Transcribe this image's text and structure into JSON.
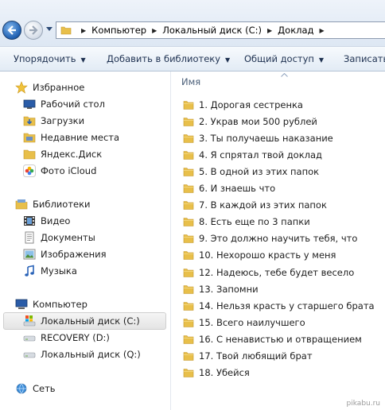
{
  "address_bar": {
    "breadcrumbs": [
      "Компьютер",
      "Локальный диск (C:)",
      "Доклад"
    ]
  },
  "toolbar": {
    "organize_label": "Упорядочить",
    "add_to_library_label": "Добавить в библиотеку",
    "share_label": "Общий доступ",
    "burn_label": "Записать"
  },
  "nav_pane": {
    "favorites": {
      "label": "Избранное",
      "items": [
        "Рабочий стол",
        "Загрузки",
        "Недавние места",
        "Яндекс.Диск",
        "Фото iCloud"
      ]
    },
    "libraries": {
      "label": "Библиотеки",
      "items": [
        "Видео",
        "Документы",
        "Изображения",
        "Музыка"
      ]
    },
    "computer": {
      "label": "Компьютер",
      "items": [
        "Локальный диск (C:)",
        "RECOVERY (D:)",
        "Локальный диск (Q:)"
      ],
      "selected_item": "Локальный диск (C:)"
    },
    "network": {
      "label": "Сеть"
    }
  },
  "file_list": {
    "column_header": "Имя",
    "items": [
      "1. Дорогая сестренка",
      "2. Украв мои 500 рублей",
      "3. Ты получаешь наказание",
      "4. Я спрятал твой доклад",
      "5. В одной из этих папок",
      "6. И знаешь что",
      "7. В каждой из этих папок",
      "8. Есть еще по 3 папки",
      "9. Это должно научить тебя, что",
      "10. Нехорошо красть у меня",
      "12. Надеюсь, тебе будет весело",
      "13.  Запомни",
      "14. Нельзя красть у старшего брата",
      "15. Всего наилучшего",
      "16. С ненавистью и отвращением",
      "17. Твой любящий брат",
      "18. Убейся"
    ]
  },
  "watermark": "pikabu.ru",
  "colors": {
    "folder": "#e8bf4a",
    "selection": "#e6e6e6",
    "header_text": "#4c607a"
  }
}
